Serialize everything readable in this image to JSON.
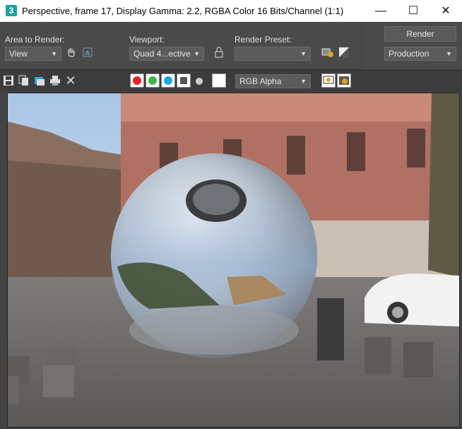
{
  "window": {
    "title": "Perspective, frame 17, Display Gamma: 2.2, RGBA Color 16 Bits/Channel (1:1)",
    "app_icon": "3",
    "minimize": "—",
    "maximize": "☐",
    "close": "✕"
  },
  "render_setup": {
    "area_label": "Area to Render:",
    "area_value": "View",
    "viewport_label": "Viewport:",
    "viewport_value": "Quad 4...ective",
    "preset_label": "Render Preset:",
    "preset_value": "",
    "render_button": "Render",
    "production_value": "Production"
  },
  "frame_toolbar": {
    "channel_value": "RGB Alpha",
    "icons": [
      "save-icon",
      "copy-icon",
      "clone-icon",
      "print-icon",
      "clear-icon"
    ],
    "red": "#e8262a",
    "green": "#3fb64a",
    "blue": "#1aa8e0"
  }
}
